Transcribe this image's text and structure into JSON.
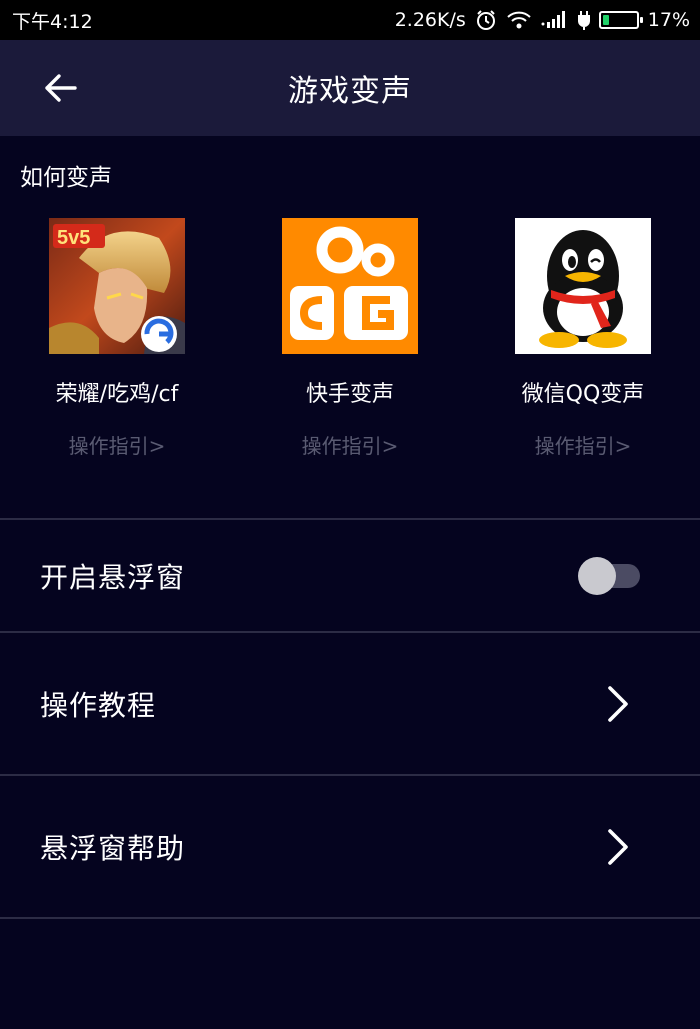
{
  "status_bar": {
    "time": "下午4:12",
    "network_speed": "2.26K/s",
    "battery_percent": "17%",
    "battery_level": 0.17,
    "icons": [
      "alarm-icon",
      "wifi-icon",
      "signal-icon",
      "charging-icon",
      "battery-icon"
    ]
  },
  "header": {
    "title": "游戏变声",
    "back_icon": "arrow-left-icon"
  },
  "section": {
    "title": "如何变声"
  },
  "apps": [
    {
      "name": "荣耀/吃鸡/cf",
      "guide": "操作指引>",
      "icon": "game-icon"
    },
    {
      "name": "快手变声",
      "guide": "操作指引>",
      "icon": "kuaishou-icon"
    },
    {
      "name": "微信QQ变声",
      "guide": "操作指引>",
      "icon": "qq-penguin-icon"
    }
  ],
  "settings": {
    "floating_window": {
      "label": "开启悬浮窗",
      "enabled": false
    },
    "tutorial": {
      "label": "操作教程"
    },
    "floating_help": {
      "label": "悬浮窗帮助"
    }
  },
  "colors": {
    "background": "#05041f",
    "header": "#1b1a3a",
    "divider": "#2c2c45",
    "guide_text": "#5a5b72",
    "kuaishou_orange": "#ff8a00"
  }
}
